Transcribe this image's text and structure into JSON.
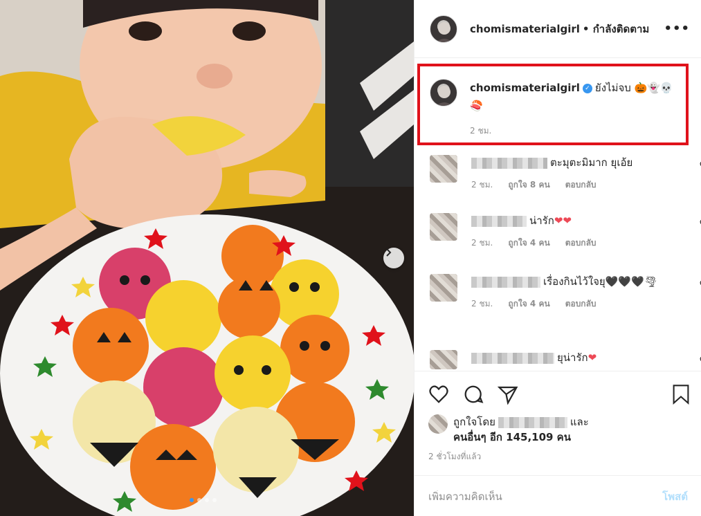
{
  "post": {
    "username": "chomismaterialgirl",
    "follow_status": "• กำลังติดตาม",
    "more_icon": "more-horizontal-icon",
    "carousel_dots": 4
  },
  "caption": {
    "username": "chomismaterialgirl",
    "text": "ยังไม่จบ 🎃👻💀🍣",
    "time": "2 ชม."
  },
  "comments": [
    {
      "text": "ตะมุตะมิมาก ยุเอ้ย",
      "time": "2 ชม.",
      "likes": "ถูกใจ 8 คน",
      "reply": "ตอบกลับ"
    },
    {
      "text": "น่ารัก",
      "emoji": "❤❤",
      "time": "2 ชม.",
      "likes": "ถูกใจ 4 คน",
      "reply": "ตอบกลับ"
    },
    {
      "text": "เรื่องกินไว้ใจยุ🖤🖤🖤🌪",
      "time": "2 ชม.",
      "likes": "ถูกใจ 4 คน",
      "reply": "ตอบกลับ"
    },
    {
      "text": "ยุน่ารัก",
      "emoji": "❤"
    }
  ],
  "likes": {
    "prefix": "ถูกใจโดย",
    "mid": "และ",
    "others": "คนอื่นๆ อีก 145,109 คน"
  },
  "posted_ago": "2 ชั่วโมงที่แล้ว",
  "comment_bar": {
    "placeholder": "เพิ่มความคิดเห็น",
    "post_label": "โพสต์"
  },
  "colors": {
    "accent": "#3897f0",
    "highlight_border": "#e0121b",
    "heart": "#ed4956"
  }
}
